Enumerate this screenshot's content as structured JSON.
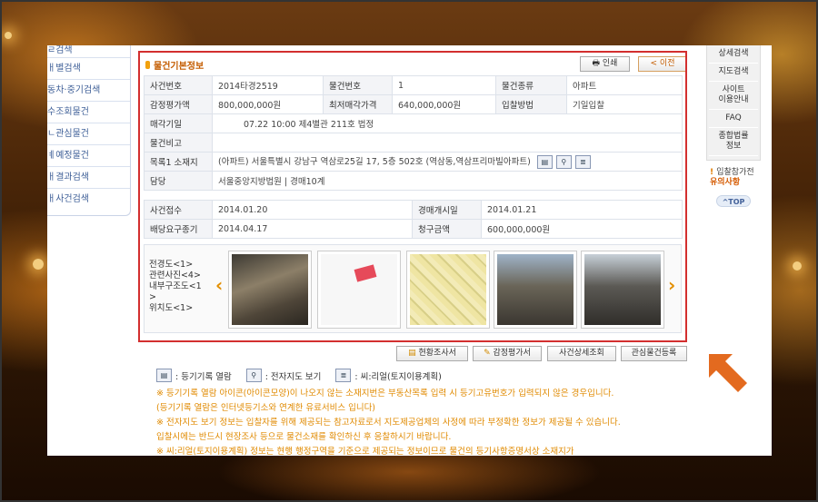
{
  "left_sidebar": {
    "items": [
      "ㄹ검색",
      "ㅐ별검색",
      "동차·중기검색",
      "수조회물건",
      "ㄴ관심물건",
      "ㅖ예정물건",
      "ㅐ결과검색",
      "ㅐ사건검색"
    ]
  },
  "right_sidebar": {
    "items": [
      "상세검색",
      "지도검색",
      "사이트\n이용안내",
      "FAQ",
      "종합법률\n정보"
    ],
    "caution_line1": "입찰참가전",
    "caution_line2": "유의사항",
    "top_label": "^TOP"
  },
  "section": {
    "title": "물건기본정보",
    "print_label": "인쇄",
    "prev_label": "< 이전"
  },
  "info": {
    "case_no_label": "사건번호",
    "case_no": "2014타경2519",
    "item_no_label": "물건번호",
    "item_no": "1",
    "item_type_label": "물건종류",
    "item_type": "아파트",
    "appraisal_label": "감정평가액",
    "appraisal": "800,000,000원",
    "min_price_label": "최저매각가격",
    "min_price": "640,000,000원",
    "bid_method_label": "입찰방법",
    "bid_method": "기일입찰",
    "sale_date_label": "매각기일",
    "sale_date": "07.22 10:00 제4별관 211호 법정",
    "note_label": "물건비고",
    "note": "",
    "address_label": "목록1 소재지",
    "address": "(아파트) 서울특별시 강남구 역삼로25길 17, 5층 502호 (역삼동,역삼프리마빌아파트)",
    "manager_label": "담당",
    "manager": "서울중앙지방법원 | 경매10계",
    "received_label": "사건접수",
    "received": "2014.01.20",
    "auction_start_label": "경매개시일",
    "auction_start": "2014.01.21",
    "dividend_end_label": "배당요구종기",
    "dividend_end": "2014.04.17",
    "claim_label": "청구금액",
    "claim": "600,000,000원"
  },
  "photos": {
    "labels": [
      "전경도<1>",
      "관련사진<4>",
      "내부구조도<1",
      ">",
      "위치도<1>"
    ]
  },
  "buttons": {
    "survey": "현황조사서",
    "appraisal_doc": "감정평가서",
    "case_detail": "사건상세조회",
    "interest": "관심물건등록"
  },
  "legend": {
    "registry": ": 등기기록 열람",
    "map": ": 전자지도 보기",
    "real": ": 씨:리얼(토지이용계획)"
  },
  "notes": [
    "※ 등기기록 열람 아이콘(아이콘모양)이 나오지 않는 소재지번은 부동산목록 입력 시 등기고유번호가 입력되지 않은 경우입니다.",
    "    (등기기록 열람은 인터넷등기소와 연계한 유료서비스 입니다)",
    "※ 전자지도 보기 정보는 입찰자를 위해 제공되는 참고자료로서 지도제공업체의 사정에 따라 부정확한 정보가 제공될 수 있습니다.",
    "    입찰시에는 반드시 현장조사 등으로 물건소재를 확인하신 후 응찰하시기 바랍니다.",
    "※ 씨:리얼(토지이용계획) 정보는 현행 행정구역을 기준으로 제공되는 정보이므로 물건의 등기사항증명서상 소재지가"
  ],
  "colors": {
    "accent_orange": "#e08a00",
    "highlight_red": "#d32f2f",
    "link_blue": "#3e5f97"
  }
}
